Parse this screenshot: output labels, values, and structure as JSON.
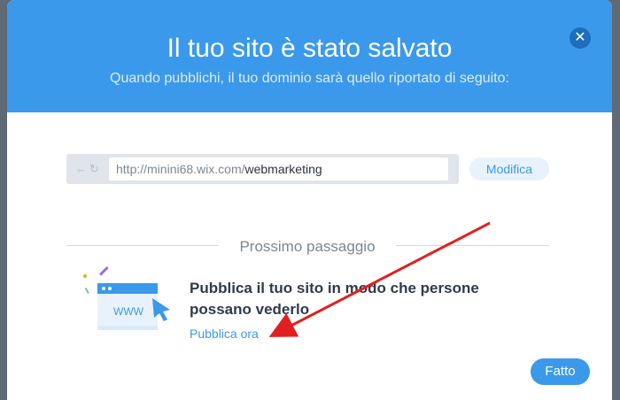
{
  "modal": {
    "title": "Il tuo sito è stato salvato",
    "subtitle": "Quando pubblichi, il tuo dominio sarà quello riportato di seguito:",
    "close_icon": "close-icon"
  },
  "address": {
    "nav_icons": "back-icon, refresh-icon",
    "url_prefix": "http://minini68.wix.com/",
    "url_path": "webmarketing",
    "modify_label": "Modifica"
  },
  "next_step": {
    "heading": "Prossimo passaggio",
    "illustration_icon": "website-browser-icon",
    "www_label": "WWW",
    "title": "Pubblica il tuo sito in modo che persone possano vederlo",
    "link": "Pubblica ora"
  },
  "footer": {
    "done_label": "Fatto"
  },
  "colors": {
    "header": "#3b99ec",
    "accent": "#3b99ec",
    "annotation_arrow": "#e02020"
  }
}
